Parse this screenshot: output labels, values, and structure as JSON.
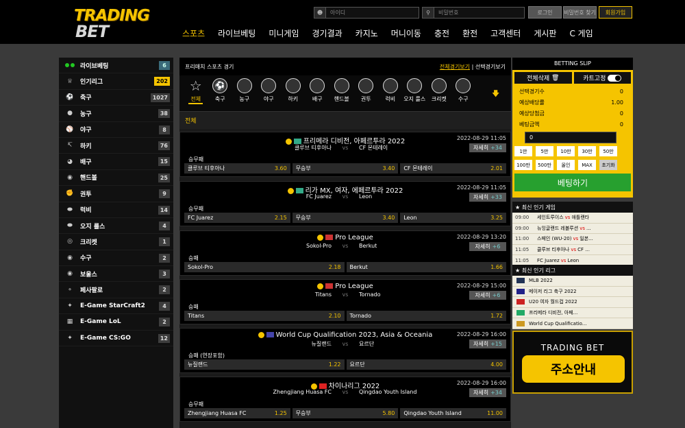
{
  "brand": {
    "line1": "TRADING",
    "line2": "BET"
  },
  "login": {
    "id_placeholder": "아이디",
    "pw_placeholder": "비밀번호",
    "login_btn": "로그인",
    "find_btn": "비밀번호 찾기",
    "join_btn": "회원가입"
  },
  "nav": [
    "스포츠",
    "라이브베팅",
    "미니게임",
    "경기결과",
    "카지노",
    "머니이동",
    "충전",
    "환전",
    "고객센터",
    "게시판",
    "C 게임"
  ],
  "sidebar": [
    {
      "label": "라이브베팅",
      "count": "6",
      "icon": "live-dots"
    },
    {
      "label": "인기리그",
      "count": "202",
      "icon": "trophy-icon"
    },
    {
      "label": "축구",
      "count": "1027",
      "icon": "soccer-icon"
    },
    {
      "label": "농구",
      "count": "38",
      "icon": "basketball-icon"
    },
    {
      "label": "야구",
      "count": "8",
      "icon": "baseball-icon"
    },
    {
      "label": "하키",
      "count": "76",
      "icon": "hockey-icon"
    },
    {
      "label": "배구",
      "count": "15",
      "icon": "volleyball-icon"
    },
    {
      "label": "핸드볼",
      "count": "25",
      "icon": "handball-icon"
    },
    {
      "label": "권투",
      "count": "9",
      "icon": "boxing-icon"
    },
    {
      "label": "럭비",
      "count": "14",
      "icon": "rugby-icon"
    },
    {
      "label": "오지 룰스",
      "count": "4",
      "icon": "aussie-rules-icon"
    },
    {
      "label": "크리켓",
      "count": "1",
      "icon": "cricket-icon"
    },
    {
      "label": "수구",
      "count": "2",
      "icon": "water-polo-icon"
    },
    {
      "label": "보울스",
      "count": "3",
      "icon": "bowls-icon"
    },
    {
      "label": "페사팔로",
      "count": "2",
      "icon": "pesapallo-icon"
    },
    {
      "label": "E-Game StarCraft2",
      "count": "4",
      "icon": "starcraft-icon"
    },
    {
      "label": "E-Game LoL",
      "count": "2",
      "icon": "lol-icon"
    },
    {
      "label": "E-Game CS:GO",
      "count": "12",
      "icon": "csgo-icon"
    }
  ],
  "main": {
    "title": "프리매치 스포츠 경기",
    "link_all": "전체경기보기",
    "link_sep": "|",
    "link_select": "선택경기보기",
    "sports": [
      "전체",
      "축구",
      "농구",
      "야구",
      "하키",
      "배구",
      "핸드볼",
      "권투",
      "럭비",
      "오지 룰스",
      "크리켓",
      "수구"
    ],
    "all_label": "전체",
    "more_label": "자세히",
    "vs": "vs"
  },
  "matches": [
    {
      "league": "프리메라 디비전, 아페르투라 2022",
      "home": "클루브 티후아나",
      "away": "CF 몬테레이",
      "date": "2022-08-29 11:05",
      "more": "+34",
      "market": "승무패",
      "odds": [
        {
          "name": "클루브 티후아나",
          "val": "3.60"
        },
        {
          "name": "무승부",
          "val": "3.40"
        },
        {
          "name": "CF 몬테레이",
          "val": "2.01"
        }
      ]
    },
    {
      "league": "리가 MX, 여자, 에페르투라 2022",
      "home": "FC Juarez",
      "away": "Leon",
      "date": "2022-08-29 11:05",
      "more": "+33",
      "market": "승무패",
      "odds": [
        {
          "name": "FC Juarez",
          "val": "2.15"
        },
        {
          "name": "무승부",
          "val": "3.40"
        },
        {
          "name": "Leon",
          "val": "3.25"
        }
      ]
    },
    {
      "league": "Pro League",
      "home": "Sokol-Pro",
      "away": "Berkut",
      "date": "2022-08-29 13:20",
      "more": "+6",
      "market": "승패",
      "odds": [
        {
          "name": "Sokol-Pro",
          "val": "2.18"
        },
        {
          "name": "Berkut",
          "val": "1.66"
        }
      ]
    },
    {
      "league": "Pro League",
      "home": "Titans",
      "away": "Tornado",
      "date": "2022-08-29 15:00",
      "more": "+6",
      "market": "승패",
      "odds": [
        {
          "name": "Titans",
          "val": "2.10"
        },
        {
          "name": "Tornado",
          "val": "1.72"
        }
      ]
    },
    {
      "league": "World Cup Qualification 2023, Asia & Oceania",
      "home": "뉴질랜드",
      "away": "요르단",
      "date": "2022-08-29 16:00",
      "more": "+15",
      "market": "승패 (연장포함)",
      "odds": [
        {
          "name": "뉴질랜드",
          "val": "1.22"
        },
        {
          "name": "요르단",
          "val": "4.00"
        }
      ]
    },
    {
      "league": "차이나리그 2022",
      "home": "Zhengjiang Huasa FC",
      "away": "Qingdao Youth Island",
      "date": "2022-08-29 16:00",
      "more": "+34",
      "market": "승무패",
      "odds": [
        {
          "name": "Zhengjiang Huasa FC",
          "val": "1.25"
        },
        {
          "name": "무승부",
          "val": "5.80"
        },
        {
          "name": "Qingdao Youth Island",
          "val": "11.00"
        }
      ]
    }
  ],
  "slip": {
    "title": "BETTING SLIP",
    "clear": "전체삭제",
    "fix": "카트고정",
    "rows": [
      {
        "k": "선택경기수",
        "v": "0"
      },
      {
        "k": "예상배당률",
        "v": "1.00"
      },
      {
        "k": "예상당첨금",
        "v": "0"
      },
      {
        "k": "베팅금액",
        "v": "0"
      }
    ],
    "amount": "0",
    "chips": [
      "1만",
      "5만",
      "10만",
      "30만",
      "50만",
      "",
      "100만",
      "500만",
      "올인",
      "MAX",
      "초기화",
      ""
    ],
    "bet": "베팅하기"
  },
  "hot_games": {
    "title": "최신 인기 게임",
    "rows": [
      {
        "time": "09:00",
        "home": "세인트루이스",
        "away": "애틀랜타"
      },
      {
        "time": "09:00",
        "home": "뉴잉글랜드 레볼루션",
        "away": "..."
      },
      {
        "time": "11:00",
        "home": "스페인 (WU-20)",
        "away": "일본..."
      },
      {
        "time": "11:05",
        "home": "클루브 티후아나",
        "away": "CF ..."
      },
      {
        "time": "11:05",
        "home": "FC Juarez",
        "away": "Leon"
      }
    ]
  },
  "hot_leagues": {
    "title": "최신 인기 리그",
    "rows": [
      "MLB 2022",
      "메이저 리그 축구 2022",
      "U20 여자 월드컵 2022",
      "프리메라 디비전, 아페...",
      "World Cup Qualificatio..."
    ]
  },
  "banner": {
    "top": "TRADING BET",
    "main": "주소안내"
  }
}
